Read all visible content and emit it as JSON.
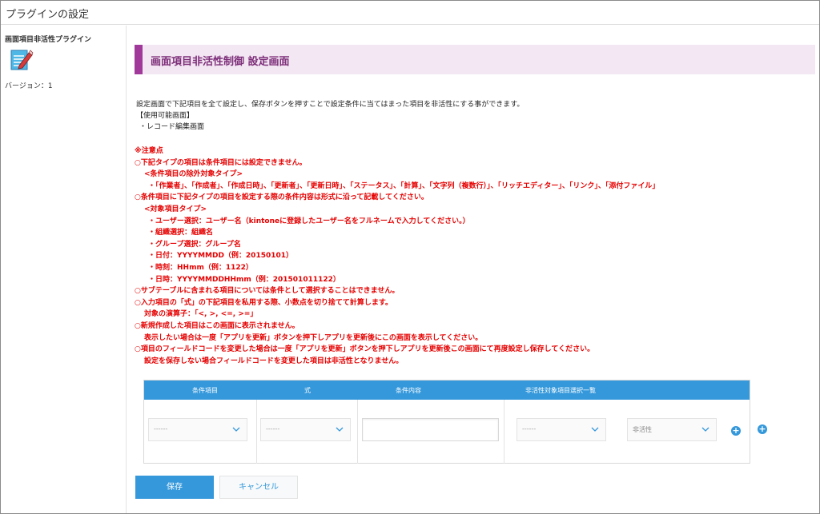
{
  "window": {
    "title": "プラグインの設定"
  },
  "sidebar": {
    "plugin_name": "画面項目非活性プラグイン",
    "plugin_icon": "edit-document-icon",
    "version": "バージョン：1"
  },
  "header": {
    "title": "画面項目非活性制御 設定画面"
  },
  "description": [
    "設定画面で下記項目を全て設定し、保存ボタンを押すことで設定条件に当てはまった項目を非活性にする事ができます。",
    "【使用可能画面】",
    "・レコード編集画面"
  ],
  "notes": [
    {
      "text": "※注意点",
      "indent": 0
    },
    {
      "text": "○下記タイプの項目は条件項目には設定できません。",
      "indent": 0
    },
    {
      "text": "<条件項目の除外対象タイプ>",
      "indent": 1
    },
    {
      "text": "・「作業者」、「作成者」、「作成日時」、「更新者」、「更新日時」、「ステータス」、「計算」、「文字列（複数行）」、「リッチエディター」、「リンク」、「添付ファイル」",
      "indent": 2
    },
    {
      "text": "○条件項目に下記タイプの項目を設定する際の条件内容は形式に沿って記載してください。",
      "indent": 0
    },
    {
      "text": "<対象項目タイプ>",
      "indent": 1
    },
    {
      "text": "・ユーザー選択：ユーザー名（kintoneに登録したユーザー名をフルネームで入力してください。）",
      "indent": 2
    },
    {
      "text": "・組織選択：組織名",
      "indent": 2
    },
    {
      "text": "・グループ選択：グループ名",
      "indent": 2
    },
    {
      "text": "・日付：YYYYMMDD（例：20150101）",
      "indent": 2
    },
    {
      "text": "・時刻：HHmm（例：1122）",
      "indent": 2
    },
    {
      "text": "・日時：YYYYMMDDHHmm（例：201501011122）",
      "indent": 2
    },
    {
      "text": "○サブテーブルに含まれる項目については条件として選択することはできません。",
      "indent": 0
    },
    {
      "text": "○入力項目の「式」の下記項目を私用する際、小数点を切り捨てて計算します。",
      "indent": 0
    },
    {
      "text": "対象の演算子：「<, >, <=, >=」",
      "indent": 1
    },
    {
      "text": "○新規作成した項目はこの画面に表示されません。",
      "indent": 0
    },
    {
      "text": "表示したい場合は一度「アプリを更新」ボタンを押下しアプリを更新後にこの画面を表示してください。",
      "indent": 1
    },
    {
      "text": "○項目のフィールドコードを変更した場合は一度「アプリを更新」ボタンを押下しアプリを更新後この画面にて再度設定し保存してください。",
      "indent": 0
    },
    {
      "text": "設定を保存しない場合フィールドコードを変更した項目は非活性となりません。",
      "indent": 1
    }
  ],
  "table": {
    "headers": [
      "条件項目",
      "式",
      "条件内容",
      "非活性対象項目選択一覧"
    ],
    "row": {
      "condition_field": "------",
      "operator": "------",
      "condition_value": "",
      "target_field": "------",
      "state": "非活性"
    },
    "add_icon": "plus-circle-icon"
  },
  "buttons": {
    "save": "保存",
    "cancel": "キャンセル"
  },
  "colors": {
    "accent": "#3498db",
    "header_bar": "#a0399a",
    "header_bg": "#f3e7f3",
    "notes": "#e60000"
  }
}
